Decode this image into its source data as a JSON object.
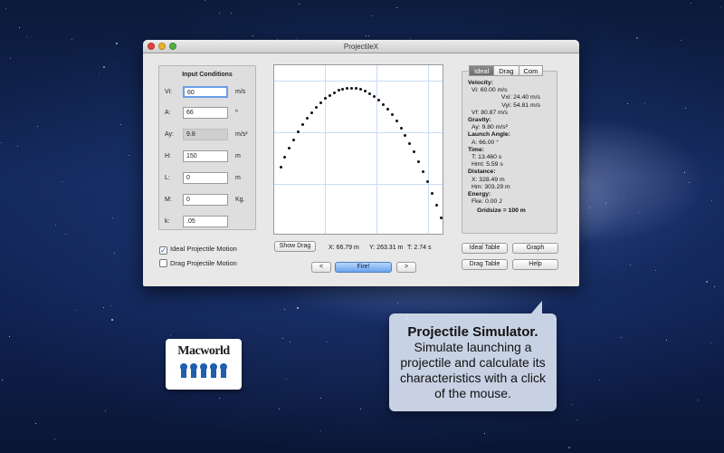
{
  "window": {
    "title": "ProjectileX"
  },
  "input_panel": {
    "title": "Input Conditions",
    "rows": [
      {
        "label": "Vi:",
        "value": "60",
        "unit": "m/s"
      },
      {
        "label": "A:",
        "value": "66",
        "unit": "º"
      },
      {
        "label": "Ay:",
        "value": "9.8",
        "unit": "m/s²"
      },
      {
        "label": "H:",
        "value": "150",
        "unit": "m"
      },
      {
        "label": "L:",
        "value": "0",
        "unit": "m"
      },
      {
        "label": "M:",
        "value": "0",
        "unit": "Kg."
      },
      {
        "label": "k:",
        "value": ".05",
        "unit": ""
      }
    ]
  },
  "options": {
    "ideal_label": "Ideal Projectile Motion",
    "drag_label": "Drag Projectile Motion",
    "ideal_checked": "✓"
  },
  "buttons": {
    "show_drag": "Show Drag",
    "prev": "<",
    "fire": "Fire!",
    "next": ">",
    "ideal_table": "Ideal Table",
    "graph": "Graph",
    "drag_table": "Drag Table",
    "help": "Help"
  },
  "readout": {
    "x": "X:  66.79 m",
    "y": "Y:  263.31 m",
    "t": "T:  2.74 s"
  },
  "tabs": [
    "Ideal",
    "Drag",
    "Com"
  ],
  "results": {
    "velocity_title": "Velocity:",
    "vi": "Vi: 60.00 m/s",
    "vxi": "Vxi: 24.40 m/s",
    "vyi": "Vyi: 54.81 m/s",
    "vf": "Vf: 80.87 m/s",
    "gravity_title": "Gravity:",
    "ay": "Ay: 9.80 m/s²",
    "angle_title": "Launch Angle:",
    "a": "A: 66.00 °",
    "time_title": "Time:",
    "t": "T: 13.460 s",
    "hmt": "Hmt: 5.59 s",
    "distance_title": "Distance:",
    "x": "X: 328.49 m",
    "hm": "Hm: 303.29 m",
    "energy_title": "Energy:",
    "fke": "Fke: 0.00 J",
    "gridsize": "Gridsize = 100 m"
  },
  "callout": {
    "title": "Projectile Simulator.",
    "body_lines": [
      "Simulate launching a",
      "projectile and calculate its",
      "characteristics with a click",
      "of the mouse."
    ]
  },
  "badge": {
    "brand": "Macworld"
  },
  "trajectory": {
    "gridsize_m": 100,
    "launch_speed_mps": 60,
    "launch_angle_deg": 66,
    "launch_height_m": 150,
    "gravity_mps2": 9.8,
    "flight_time_s": 13.46
  }
}
